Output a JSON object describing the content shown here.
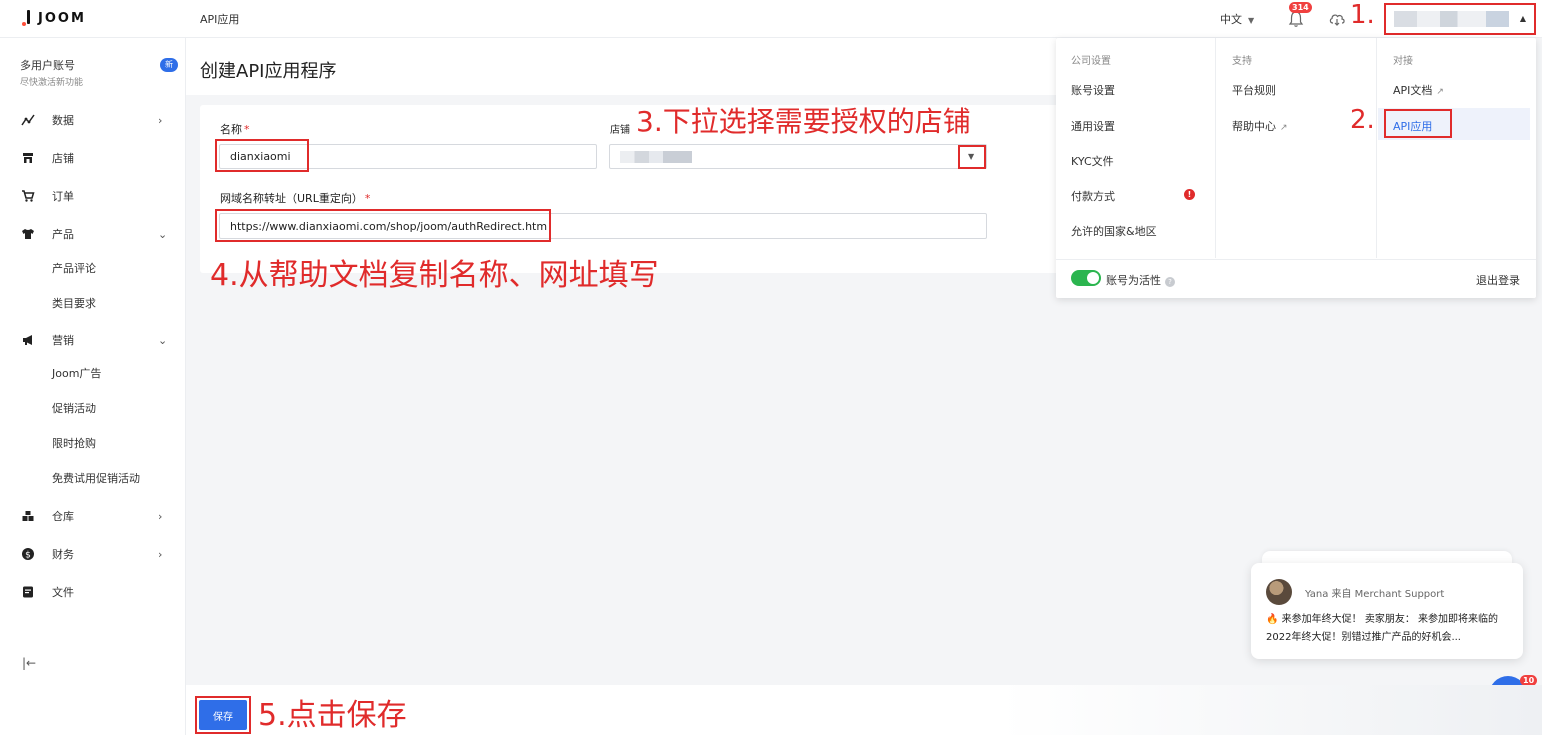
{
  "topbar": {
    "logo_text": "JOOM",
    "page_crumb": "API应用",
    "language": "中文",
    "notification_count": "314",
    "chat_count": "10"
  },
  "sidebar": {
    "multi_title": "多用户账号",
    "multi_sub": "尽快激活新功能",
    "new_badge": "新",
    "items": [
      {
        "label": "数据",
        "icon": "chart-line-icon"
      },
      {
        "label": "店铺",
        "icon": "store-icon"
      },
      {
        "label": "订单",
        "icon": "cart-icon"
      },
      {
        "label": "产品",
        "icon": "shirt-icon"
      },
      {
        "label": "产品评论"
      },
      {
        "label": "类目要求"
      },
      {
        "label": "营销",
        "icon": "megaphone-icon"
      },
      {
        "label": "Joom广告"
      },
      {
        "label": "促销活动"
      },
      {
        "label": "限时抢购"
      },
      {
        "label": "免费试用促销活动"
      },
      {
        "label": "仓库",
        "icon": "warehouse-icon"
      },
      {
        "label": "财务",
        "icon": "dollar-icon"
      },
      {
        "label": "文件",
        "icon": "file-icon"
      }
    ]
  },
  "main": {
    "title": "创建API应用程序",
    "name_label": "名称",
    "name_value": "dianxiaomi",
    "shop_label": "店铺",
    "url_label": "网域名称转址（URL重定向）",
    "url_value": "https://www.dianxiaomi.com/shop/joom/authRedirect.htm",
    "save_label": "保存"
  },
  "menu": {
    "col1_header": "公司设置",
    "col1": [
      "账号设置",
      "通用设置",
      "KYC文件",
      "付款方式",
      "允许的国家&地区"
    ],
    "col2_header": "支持",
    "col2": [
      "平台规则",
      "帮助中心"
    ],
    "col3_header": "对接",
    "col3": [
      "API文档",
      "API应用"
    ],
    "active_label": "账号为活性",
    "logout": "退出登录"
  },
  "chat": {
    "from": "Yana 来自 Merchant Support",
    "message": "来参加年终大促！ 卖家朋友： 来参加即将来临的2022年终大促！别错过推广产品的好机会..."
  },
  "annotations": {
    "a1": "1.",
    "a2": "2.",
    "a3": "3.下拉选择需要授权的店铺",
    "a4": "4.从帮助文档复制名称、网址填写",
    "a5": "5.点击保存"
  },
  "colors": {
    "accent": "#2f6ee8",
    "annotation_red": "#e02b2b",
    "toggle_green": "#2bb54f"
  }
}
